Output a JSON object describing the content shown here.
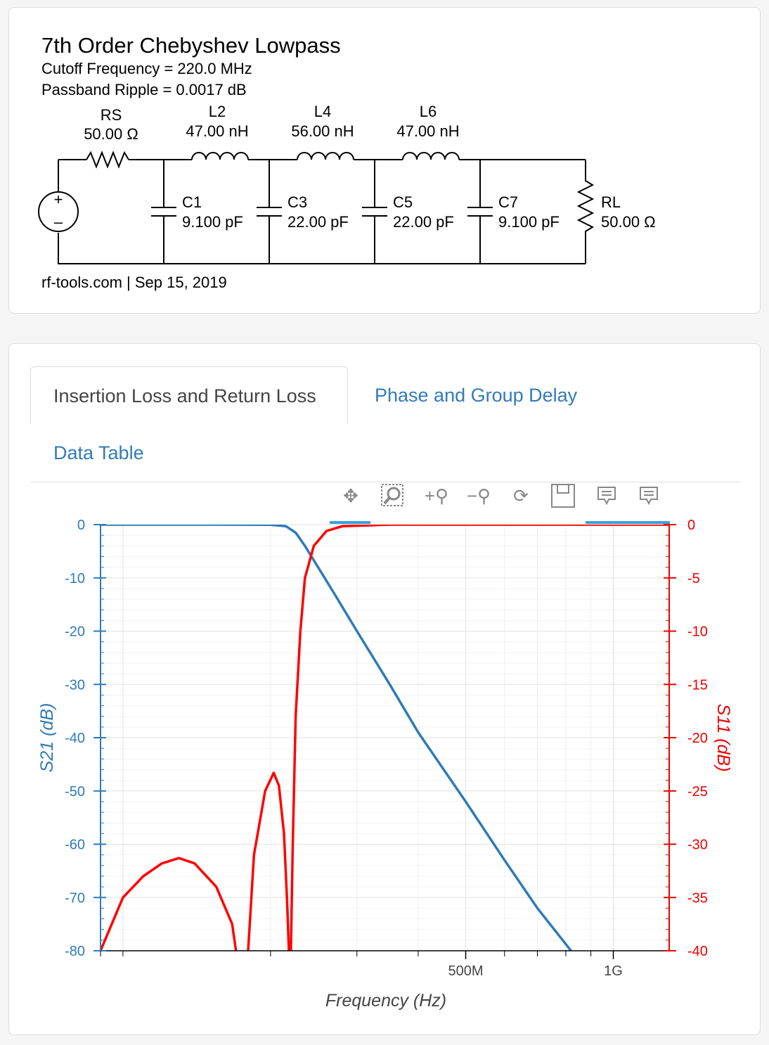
{
  "schematic": {
    "title": "7th Order Chebyshev Lowpass",
    "cutoff": "Cutoff Frequency = 220.0 MHz",
    "ripple": "Passband Ripple = 0.0017 dB",
    "footer": "rf-tools.com | Sep 15, 2019",
    "components": [
      {
        "name": "RS",
        "value": "50.00 Ω"
      },
      {
        "name": "L2",
        "value": "47.00 nH"
      },
      {
        "name": "L4",
        "value": "56.00 nH"
      },
      {
        "name": "L6",
        "value": "47.00 nH"
      },
      {
        "name": "C1",
        "value": "9.100 pF"
      },
      {
        "name": "C3",
        "value": "22.00 pF"
      },
      {
        "name": "C5",
        "value": "22.00 pF"
      },
      {
        "name": "C7",
        "value": "9.100 pF"
      },
      {
        "name": "RL",
        "value": "50.00 Ω"
      }
    ],
    "source_plus": "+",
    "source_minus": "–"
  },
  "tabs": [
    {
      "label": "Insertion Loss and Return Loss",
      "active": true
    },
    {
      "label": "Phase and Group Delay",
      "active": false
    },
    {
      "label": "Data Table",
      "active": false
    }
  ],
  "toolbar": {
    "icons": [
      "pan-icon",
      "box-zoom-icon",
      "zoom-in-icon",
      "zoom-out-icon",
      "reset-icon",
      "save-icon",
      "hover-icon",
      "hover-icon"
    ],
    "accent": "#3aa1dc"
  },
  "chart_data": {
    "type": "line",
    "xlabel": "Frequency (Hz)",
    "ylabel_left": "S21 (dB)",
    "ylabel_right": "S11 (dB)",
    "x_scale": "log",
    "xlim": [
      90000000,
      1300000000
    ],
    "x_tick_labels": [
      {
        "value": 500000000,
        "label": "500M"
      },
      {
        "value": 1000000000,
        "label": "1G"
      }
    ],
    "ylim_left": [
      -80,
      0
    ],
    "ylim_right": [
      -40,
      0
    ],
    "y_ticks_left": [
      "0",
      "-10",
      "-20",
      "-30",
      "-40",
      "-50",
      "-60",
      "-70",
      "-80"
    ],
    "y_ticks_right": [
      "0",
      "-5",
      "-10",
      "-15",
      "-20",
      "-25",
      "-30",
      "-35",
      "-40"
    ],
    "grid": true,
    "series": [
      {
        "name": "S21",
        "axis": "left",
        "color": "#2f7ab8",
        "points": [
          [
            90000000,
            0
          ],
          [
            150000000,
            0
          ],
          [
            200000000,
            -0.02
          ],
          [
            215000000,
            -0.3
          ],
          [
            225000000,
            -1.5
          ],
          [
            235000000,
            -4
          ],
          [
            250000000,
            -8
          ],
          [
            270000000,
            -13
          ],
          [
            300000000,
            -20
          ],
          [
            350000000,
            -30
          ],
          [
            400000000,
            -39
          ],
          [
            500000000,
            -52
          ],
          [
            600000000,
            -63
          ],
          [
            700000000,
            -72
          ],
          [
            820000000,
            -80
          ]
        ]
      },
      {
        "name": "S11",
        "axis": "right",
        "color": "#ff0000",
        "points": [
          [
            90000000,
            -40
          ],
          [
            100000000,
            -35
          ],
          [
            110000000,
            -33
          ],
          [
            120000000,
            -31.8
          ],
          [
            130000000,
            -31.3
          ],
          [
            140000000,
            -31.8
          ],
          [
            155000000,
            -34
          ],
          [
            167000000,
            -37.5
          ],
          [
            170000000,
            -40
          ],
          null,
          [
            180000000,
            -40
          ],
          [
            185000000,
            -31
          ],
          [
            195000000,
            -25
          ],
          [
            203000000,
            -23.3
          ],
          [
            208000000,
            -24.5
          ],
          [
            213000000,
            -29
          ],
          [
            216000000,
            -35
          ],
          [
            218000000,
            -40
          ],
          null,
          [
            220000000,
            -40
          ],
          [
            222000000,
            -30
          ],
          [
            225000000,
            -18
          ],
          [
            230000000,
            -10
          ],
          [
            235000000,
            -5
          ],
          [
            245000000,
            -2
          ],
          [
            260000000,
            -0.6
          ],
          [
            280000000,
            -0.15
          ],
          [
            350000000,
            0
          ],
          [
            1300000000,
            0
          ]
        ]
      }
    ]
  }
}
